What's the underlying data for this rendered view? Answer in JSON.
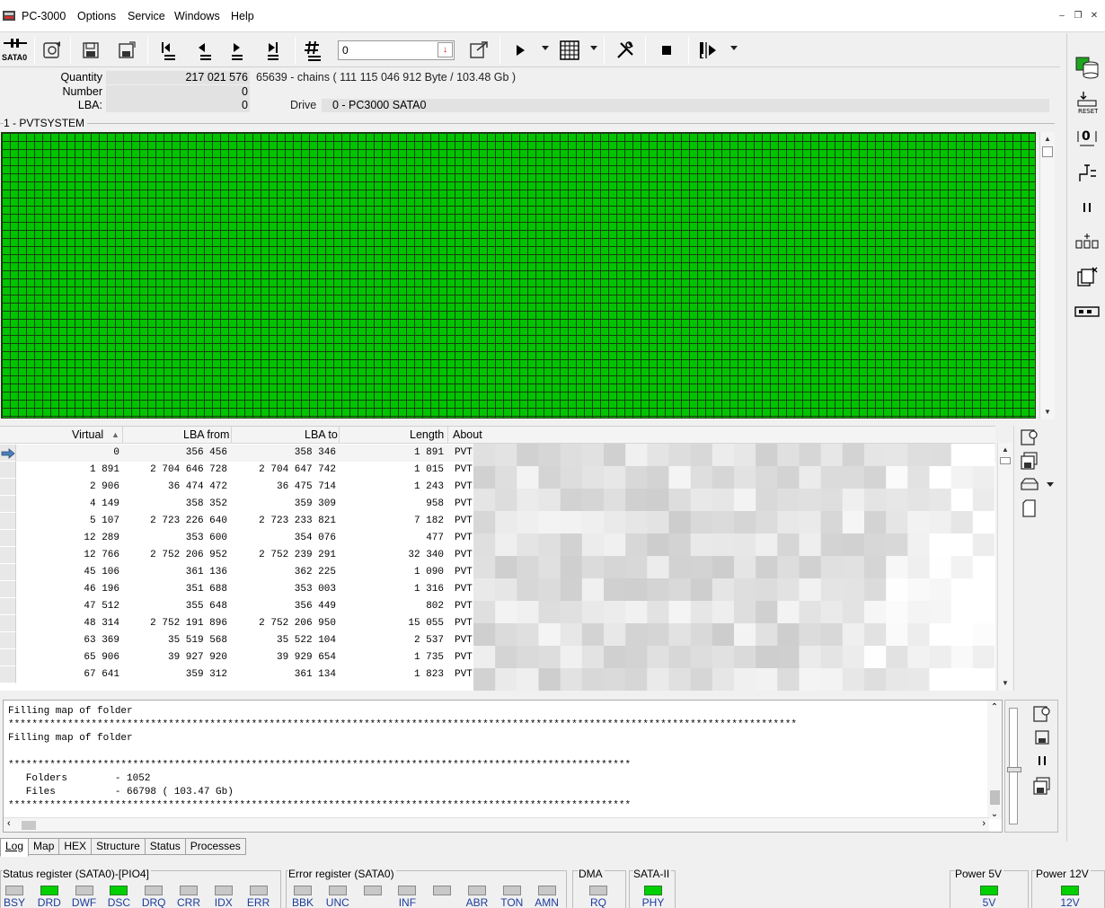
{
  "app": {
    "title": "PC-3000"
  },
  "menu": [
    "Options",
    "Service",
    "Windows",
    "Help"
  ],
  "toolbar": {
    "port_label": "SATA0",
    "lba_input_value": "0"
  },
  "info": {
    "quantity_label": "Quantity",
    "quantity_value": "217 021 576",
    "quantity_extra": "65639 - chains  ( 111 115 046 912 Byte /  103.48 Gb )",
    "number_label": "Number",
    "number_value": "0",
    "lba_label": "LBA:",
    "lba_value": "0",
    "drive_label": "Drive",
    "drive_value": "0 - PC3000 SATA0"
  },
  "map": {
    "title": "1 - PVTSYSTEM",
    "status_color": "#00c400"
  },
  "table": {
    "columns": [
      "Virtual",
      "LBA from",
      "LBA to",
      "Length",
      "About"
    ],
    "rows": [
      [
        "0",
        "356 456",
        "358 346",
        "1 891",
        "PVT"
      ],
      [
        "1 891",
        "2 704 646 728",
        "2 704 647 742",
        "1 015",
        "PVT"
      ],
      [
        "2 906",
        "36 474 472",
        "36 475 714",
        "1 243",
        "PVT"
      ],
      [
        "4 149",
        "358 352",
        "359 309",
        "958",
        "PVT"
      ],
      [
        "5 107",
        "2 723 226 640",
        "2 723 233 821",
        "7 182",
        "PVT"
      ],
      [
        "12 289",
        "353 600",
        "354 076",
        "477",
        "PVT"
      ],
      [
        "12 766",
        "2 752 206 952",
        "2 752 239 291",
        "32 340",
        "PVT"
      ],
      [
        "45 106",
        "361 136",
        "362 225",
        "1 090",
        "PVT"
      ],
      [
        "46 196",
        "351 688",
        "353 003",
        "1 316",
        "PVT"
      ],
      [
        "47 512",
        "355 648",
        "356 449",
        "802",
        "PVT"
      ],
      [
        "48 314",
        "2 752 191 896",
        "2 752 206 950",
        "15 055",
        "PVT"
      ],
      [
        "63 369",
        "35 519 568",
        "35 522 104",
        "2 537",
        "PVT"
      ],
      [
        "65 906",
        "39 927 920",
        "39 929 654",
        "1 735",
        "PVT"
      ],
      [
        "67 641",
        "359 312",
        "361 134",
        "1 823",
        "PVT"
      ]
    ]
  },
  "log": {
    "text": "Filling map of folder\n*************************************************************************************************************************************\nFilling map of folder\n\n*********************************************************************************************************\n   Folders        - 1052\n   Files          - 66798 ( 103.47 Gb)\n*********************************************************************************************************"
  },
  "tabs": [
    "Log",
    "Map",
    "HEX",
    "Structure",
    "Status",
    "Processes"
  ],
  "status": {
    "status_register_title": "Status register (SATA0)-[PIO4]",
    "status_flags": [
      {
        "label": "BSY",
        "on": false
      },
      {
        "label": "DRD",
        "on": true
      },
      {
        "label": "DWF",
        "on": false
      },
      {
        "label": "DSC",
        "on": true
      },
      {
        "label": "DRQ",
        "on": false
      },
      {
        "label": "CRR",
        "on": false
      },
      {
        "label": "IDX",
        "on": false
      },
      {
        "label": "ERR",
        "on": false
      }
    ],
    "error_register_title": "Error register (SATA0)",
    "error_flags": [
      {
        "label": "BBK",
        "on": false
      },
      {
        "label": "UNC",
        "on": false
      },
      {
        "label": "",
        "on": false
      },
      {
        "label": "INF",
        "on": false
      },
      {
        "label": "",
        "on": false
      },
      {
        "label": "ABR",
        "on": false
      },
      {
        "label": "TON",
        "on": false
      },
      {
        "label": "AMN",
        "on": false
      }
    ],
    "dma_title": "DMA",
    "dma_flag": {
      "label": "RQ",
      "on": false
    },
    "sata_title": "SATA-II",
    "sata_flag": {
      "label": "PHY",
      "on": true
    },
    "power5_title": "Power 5V",
    "power5_flag": {
      "label": "5V",
      "on": true
    },
    "power12_title": "Power 12V",
    "power12_flag": {
      "label": "12V",
      "on": true
    }
  }
}
